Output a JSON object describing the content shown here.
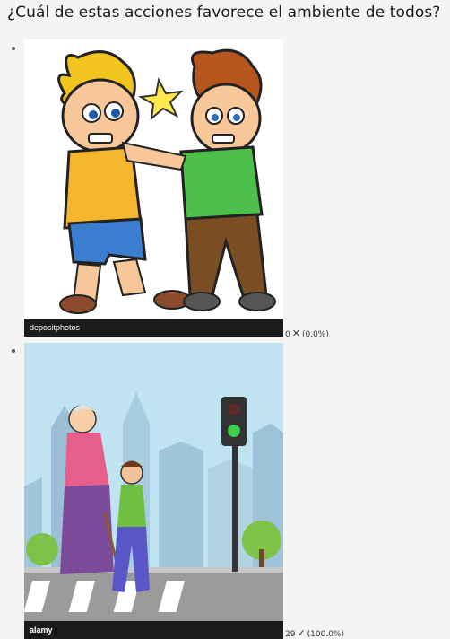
{
  "question": "¿Cuál de estas acciones favorece el ambiente de todos?",
  "options": [
    {
      "image_desc": "two-boys-fighting",
      "watermark": "depositphotos",
      "count": "0",
      "mark": "✕",
      "percent": "(0.0%)"
    },
    {
      "image_desc": "boy-helping-grandmother-cross-street",
      "watermark": "alamy",
      "count": "29",
      "mark": "✓",
      "percent": "(100.0%)"
    }
  ]
}
